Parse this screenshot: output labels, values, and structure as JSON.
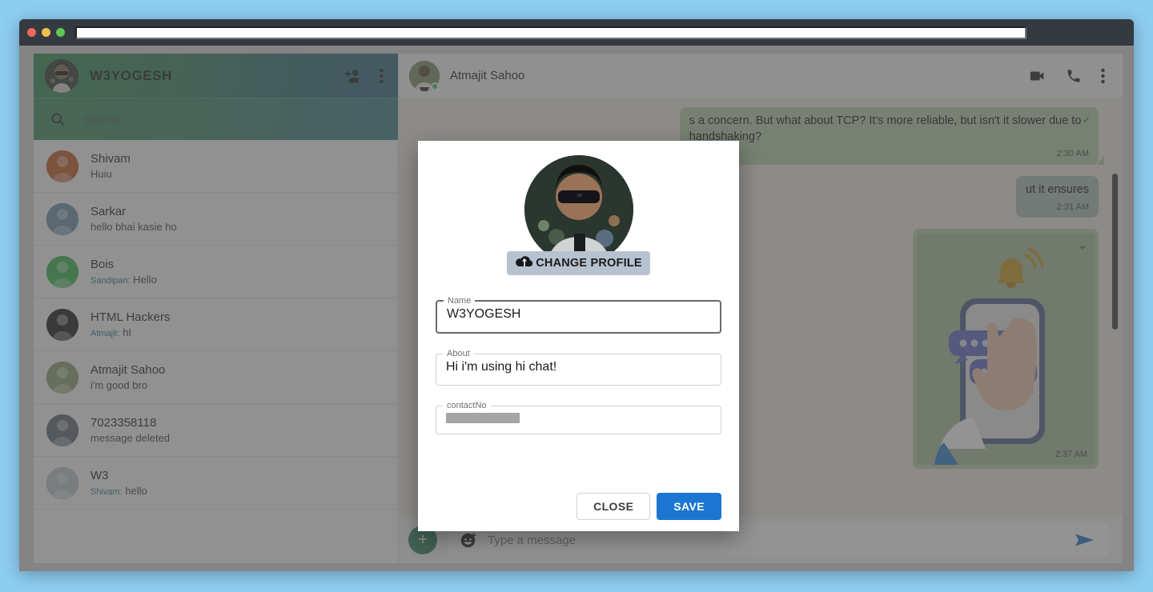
{
  "browser": {
    "url_value": "",
    "url_placeholder": "",
    "window_controls": [
      "close-dot",
      "minimize-dot",
      "maximize-dot"
    ]
  },
  "sidebar": {
    "brand": "W3YOGESH",
    "add_contact_icon": "add-person-icon",
    "menu_icon": "vertical-dots-icon",
    "search": {
      "icon": "search-icon",
      "placeholder": "Search...",
      "value": ""
    },
    "chats": [
      {
        "name": "Shivam",
        "sender": "",
        "preview": "Huiu"
      },
      {
        "name": "Sarkar",
        "sender": "",
        "preview": "hello bhai kasie ho"
      },
      {
        "name": "Bois",
        "sender": "Sandipan:",
        "preview": "Hello"
      },
      {
        "name": "HTML Hackers",
        "sender": "Atmajit:",
        "preview": "hI"
      },
      {
        "name": "Atmajit Sahoo",
        "sender": "",
        "preview": "i'm good bro"
      },
      {
        "name": "7023358118",
        "sender": "",
        "preview": "message deleted"
      },
      {
        "name": "W3",
        "sender": "Shivam:",
        "preview": "hello"
      }
    ]
  },
  "chat": {
    "contact_name": "Atmajit Sahoo",
    "presence": "online",
    "video_call_icon": "video-camera-icon",
    "voice_call_icon": "phone-icon",
    "menu_icon": "vertical-dots-icon",
    "messages": [
      {
        "type": "text",
        "direction": "out",
        "text": "s a concern. But what about TCP? It's more reliable, but isn't it slower due to handshaking?",
        "time": "2:30 AM",
        "status_icon": "double-check-icon"
      },
      {
        "type": "text",
        "direction": "out",
        "text": "ut it ensures",
        "time": "2:31 AM",
        "status_icon": ""
      },
      {
        "type": "image",
        "direction": "out",
        "alt": "3D illustration of a hand holding a phone with chat bubbles and a notification bell",
        "time": "2:37 AM",
        "chevron_icon": "chevron-down-icon"
      }
    ],
    "composer": {
      "attach_icon": "plus-icon",
      "emoji_icon": "emoji-add-icon",
      "placeholder": "Type a message",
      "value": "",
      "send_icon": "send-arrow-icon"
    }
  },
  "modal": {
    "avatar_alt": "User profile photo",
    "change_profile_label": "CHANGE PROFILE",
    "change_profile_icon": "cloud-upload-icon",
    "fields": [
      {
        "label": "Name",
        "value": "W3YOGESH",
        "redacted": false
      },
      {
        "label": "About",
        "value": "Hi i'm using hi chat!",
        "redacted": false
      },
      {
        "label": "contactNo",
        "value": "",
        "redacted": true
      }
    ],
    "close_label": "CLOSE",
    "save_label": "SAVE"
  },
  "colors": {
    "page_background": "#8ecdf2",
    "titlebar": "#343a40",
    "sidebar_header_start": "#2f8a52",
    "sidebar_header_end": "#2d6880",
    "bubble_out": "#b7ceaa",
    "save_button": "#1b76d1",
    "online_dot": "#3ccf4e"
  }
}
